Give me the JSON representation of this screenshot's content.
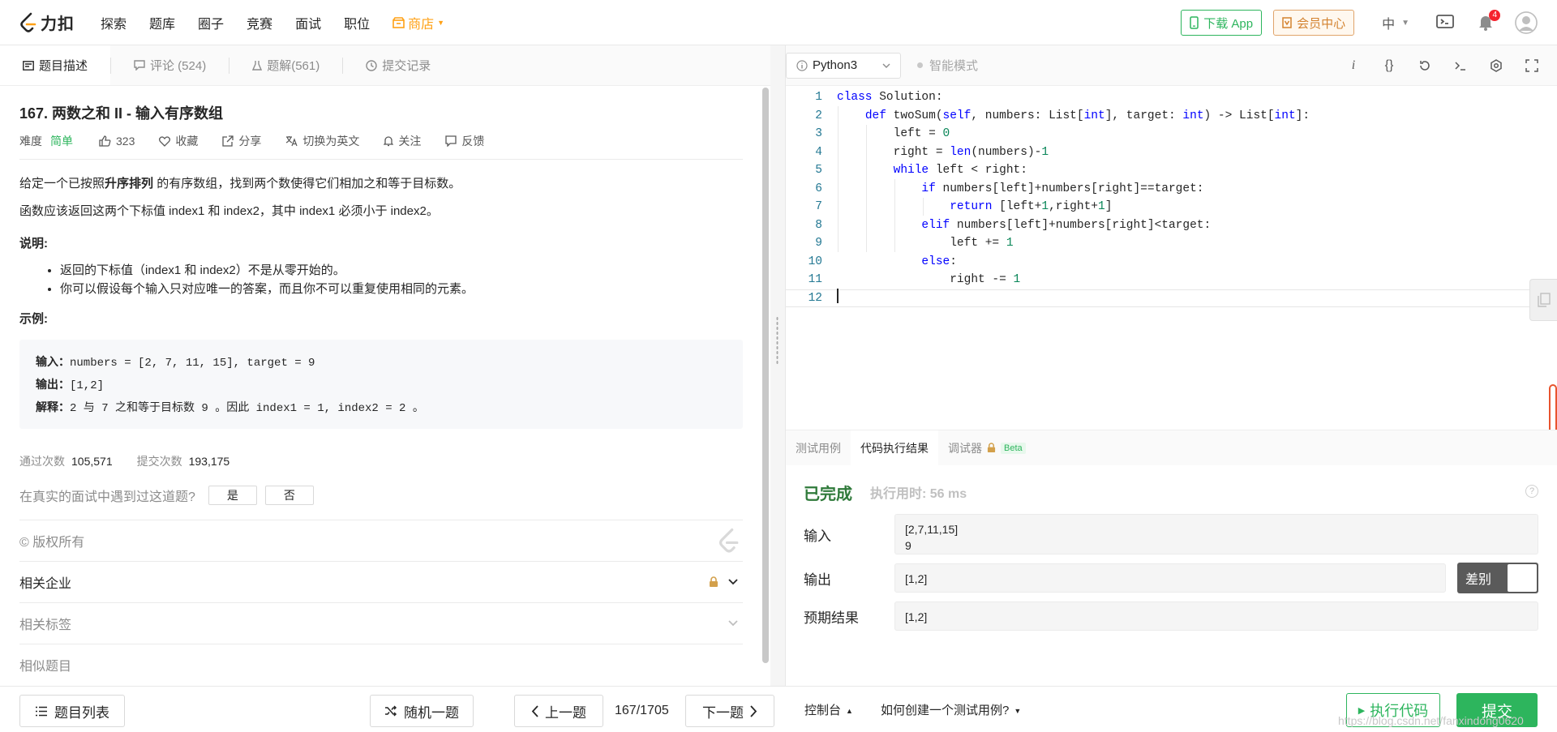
{
  "nav": {
    "logo_text": "力扣",
    "items": [
      "探索",
      "题库",
      "圈子",
      "竞赛",
      "面试",
      "职位"
    ],
    "shop": "商店",
    "download_app": "下载 App",
    "vip": "会员中心",
    "lang": "中",
    "notif_count": "4"
  },
  "tabs": {
    "description": "题目描述",
    "comments": "评论 (524)",
    "solutions": "题解(561)",
    "submissions": "提交记录"
  },
  "problem": {
    "title": "167. 两数之和 II - 输入有序数组",
    "difficulty_label": "难度",
    "difficulty": "简单",
    "likes": "323",
    "favorite": "收藏",
    "share": "分享",
    "switch_lang": "切换为英文",
    "follow": "关注",
    "feedback": "反馈",
    "p1_pre": "给定一个已按照",
    "p1_bold": "升序排列",
    "p1_post": " 的有序数组，找到两个数使得它们相加之和等于目标数。",
    "p2": "函数应该返回这两个下标值 index1 和 index2，其中 index1 必须小于 index2。",
    "note_heading": "说明:",
    "notes": [
      "返回的下标值（index1 和 index2）不是从零开始的。",
      "你可以假设每个输入只对应唯一的答案，而且你不可以重复使用相同的元素。"
    ],
    "example_heading": "示例:",
    "example": {
      "input_label": "输入：",
      "input": "numbers = [2, 7, 11, 15], target = 9",
      "output_label": "输出：",
      "output": "[1,2]",
      "explain_label": "解释：",
      "explain": "2 与 7 之和等于目标数 9 。因此 index1 = 1, index2 = 2 。"
    },
    "accepted_label": "通过次数",
    "accepted": "105,571",
    "submitted_label": "提交次数",
    "submitted": "193,175",
    "interview_q": "在真实的面试中遇到过这道题?",
    "yes": "是",
    "no": "否",
    "copyright": "© 版权所有",
    "companies": "相关企业",
    "tags": "相关标签",
    "similar": "相似题目"
  },
  "editor": {
    "language": "Python3",
    "smart_mode": "智能模式",
    "lines": [
      "class Solution:",
      "    def twoSum(self, numbers: List[int], target: int) -> List[int]:",
      "        left = 0",
      "        right = len(numbers)-1",
      "        while left < right:",
      "            if numbers[left]+numbers[right]==target:",
      "                return [left+1,right+1]",
      "            elif numbers[left]+numbers[right]<target:",
      "                left += 1",
      "            else:",
      "                right -= 1",
      ""
    ]
  },
  "bottom_tabs": {
    "testcase": "测试用例",
    "result": "代码执行结果",
    "debugger": "调试器",
    "beta": "Beta"
  },
  "result": {
    "status": "已完成",
    "runtime": "执行用时: 56 ms",
    "input_label": "输入",
    "input_line1": "[2,7,11,15]",
    "input_line2": "9",
    "output_label": "输出",
    "output": "[1,2]",
    "diff": "差别",
    "expected_label": "预期结果",
    "expected": "[1,2]"
  },
  "bottombar": {
    "problem_list": "题目列表",
    "random": "随机一题",
    "prev": "上一题",
    "page": "167/1705",
    "next": "下一题",
    "console": "控制台",
    "howto": "如何创建一个测试用例?",
    "run": "执行代码",
    "submit": "提交",
    "watermark": "https://blog.csdn.net/fanxindong0620"
  }
}
